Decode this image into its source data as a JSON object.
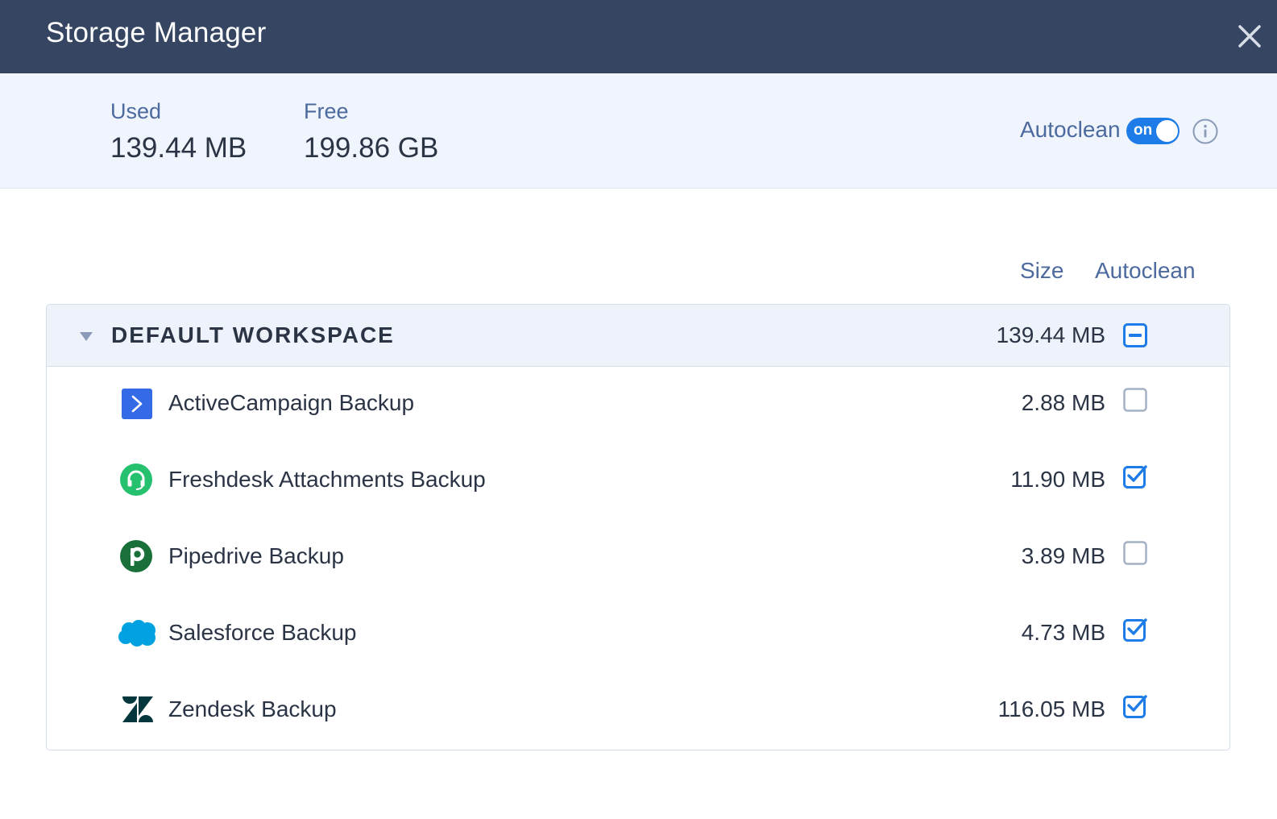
{
  "window": {
    "title": "Storage Manager"
  },
  "stats": {
    "used_label": "Used",
    "used_value": "139.44 MB",
    "free_label": "Free",
    "free_value": "199.86 GB",
    "autoclean_label": "Autoclean",
    "autoclean_toggle": "on"
  },
  "columns": {
    "size": "Size",
    "autoclean": "Autoclean"
  },
  "workspace": {
    "name": "DEFAULT WORKSPACE",
    "size": "139.44 MB",
    "autoclean_state": "partial",
    "items": [
      {
        "name": "ActiveCampaign Backup",
        "size": "2.88 MB",
        "icon": "activecampaign-icon",
        "checked": false
      },
      {
        "name": "Freshdesk Attachments Backup",
        "size": "11.90 MB",
        "icon": "freshdesk-icon",
        "checked": true
      },
      {
        "name": "Pipedrive Backup",
        "size": "3.89 MB",
        "icon": "pipedrive-icon",
        "checked": false
      },
      {
        "name": "Salesforce Backup",
        "size": "4.73 MB",
        "icon": "salesforce-icon",
        "checked": true
      },
      {
        "name": "Zendesk Backup",
        "size": "116.05 MB",
        "icon": "zendesk-icon",
        "checked": true
      }
    ]
  },
  "colors": {
    "titlebar": "#364662",
    "stats_bg": "#eff4fd",
    "accent": "#1e7ce8",
    "label": "#4c6a9e",
    "activecampaign": "#356ae6",
    "freshdesk": "#25c16f",
    "pipedrive": "#1a7039",
    "salesforce": "#00a1e0",
    "zendesk": "#03363d"
  }
}
